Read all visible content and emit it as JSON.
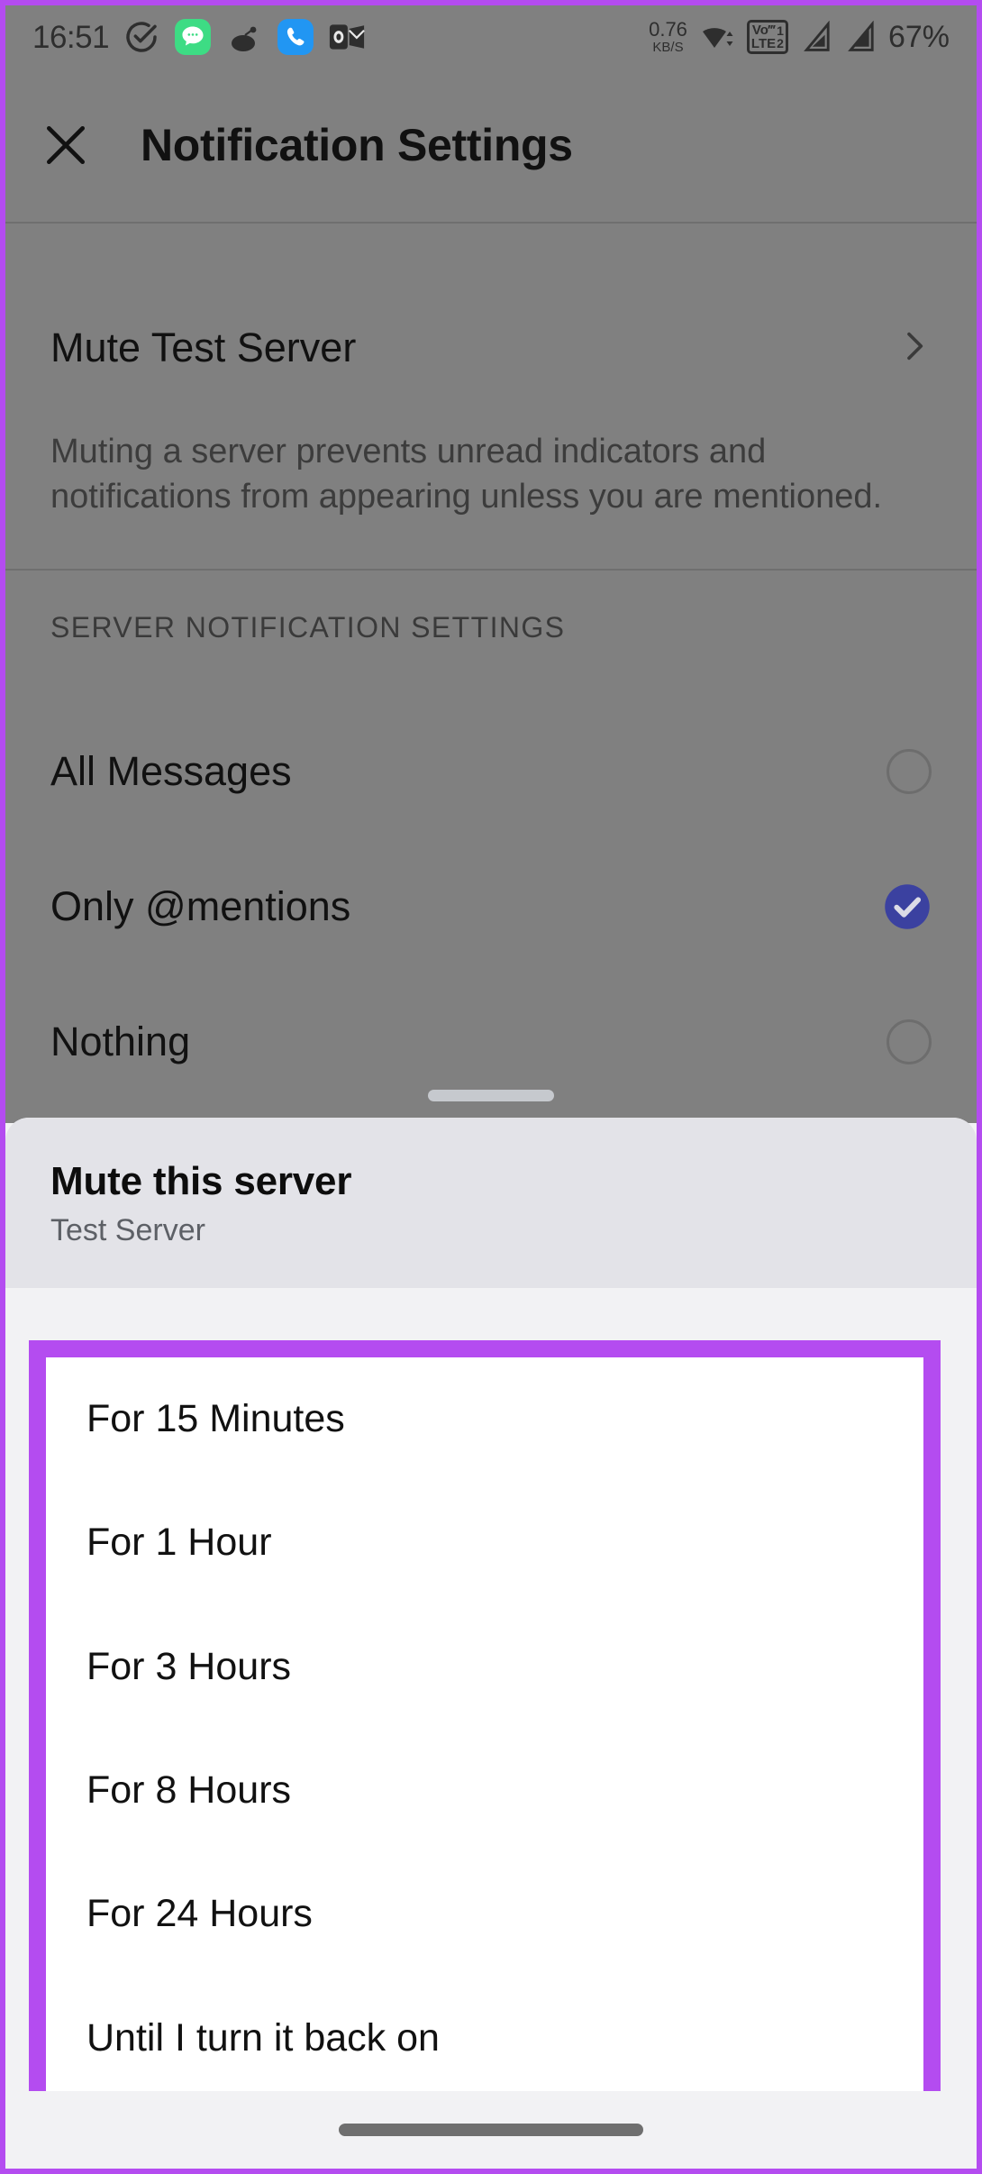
{
  "status_bar": {
    "time": "16:51",
    "icons": [
      "check-circle-icon",
      "message-bubble-icon",
      "reddit-icon",
      "phone-icon",
      "outlook-icon"
    ],
    "network_speed_value": "0.76",
    "network_speed_unit": "KB/S",
    "wifi_icon": "wifi-icon",
    "volte_label_top": "Vo‴",
    "volte_label_bottom": "LTE",
    "volte_sim1": "1",
    "volte_sim2": "2",
    "signal_icons": [
      "signal-bars-sim1-icon",
      "signal-bars-sim2-icon"
    ],
    "battery": "67%"
  },
  "app_bar": {
    "close_icon": "close-icon",
    "title": "Notification Settings"
  },
  "mute_section": {
    "row_label": "Mute Test Server",
    "chevron_icon": "chevron-right-icon",
    "description": "Muting a server prevents unread indicators and notifications from appearing unless you are mentioned."
  },
  "server_notification_settings": {
    "header": "SERVER NOTIFICATION SETTINGS",
    "options": [
      {
        "label": "All Messages",
        "selected": false
      },
      {
        "label": "Only @mentions",
        "selected": true
      },
      {
        "label": "Nothing",
        "selected": false
      }
    ]
  },
  "bottom_sheet": {
    "drag_handle": "drag-handle",
    "title": "Mute this server",
    "subtitle": "Test Server",
    "options": [
      {
        "label": "For 15 Minutes"
      },
      {
        "label": "For 1 Hour"
      },
      {
        "label": "For 3 Hours"
      },
      {
        "label": "For 8 Hours"
      },
      {
        "label": "For 24 Hours"
      },
      {
        "label": "Until I turn it back on"
      }
    ]
  },
  "nav_bar": {
    "home_indicator": "home-indicator"
  },
  "colors": {
    "scrim": "#808080",
    "accent_selected": "#3b41a0",
    "annotation_highlight": "#b44cf0",
    "sheet_header_bg": "#e3e3e8",
    "sheet_bg": "#f2f2f4",
    "list_bg": "#ffffff"
  }
}
